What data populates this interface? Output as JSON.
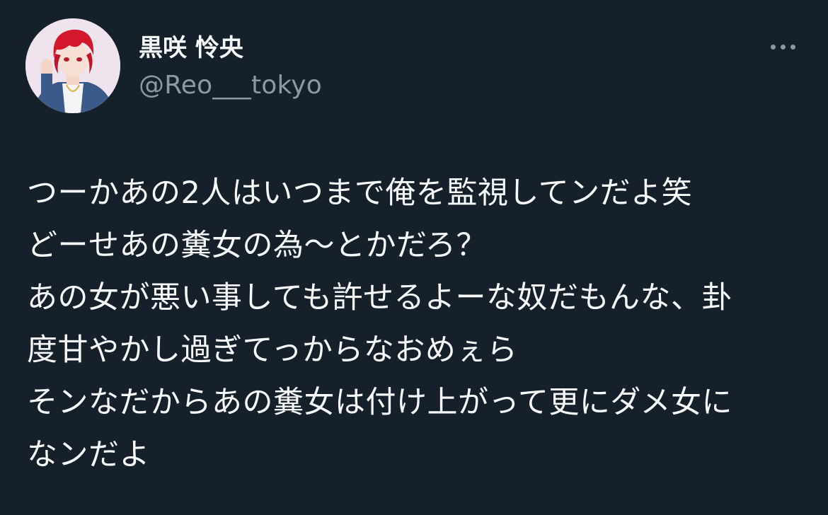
{
  "author": {
    "display_name": "黒咲 怜央",
    "handle": "@Reo___tokyo",
    "avatar_icon": "avatar-image"
  },
  "header": {
    "more_icon": "more-options-icon"
  },
  "tweet": {
    "lines": [
      "つーかあの2人はいつまで俺を監視してンだよ笑",
      "どーせあの糞女の為～とかだろ？",
      "あの女が悪い事しても許せるよーな奴だもんな、卦",
      "度甘やかし過ぎてっからなおめぇら",
      "そンなだからあの糞女は付け上がって更にダメ女に",
      "なンだよ"
    ]
  },
  "colors": {
    "background": "#15202b",
    "primary_text": "#f7f9f9",
    "secondary_text": "#8b98a5"
  }
}
